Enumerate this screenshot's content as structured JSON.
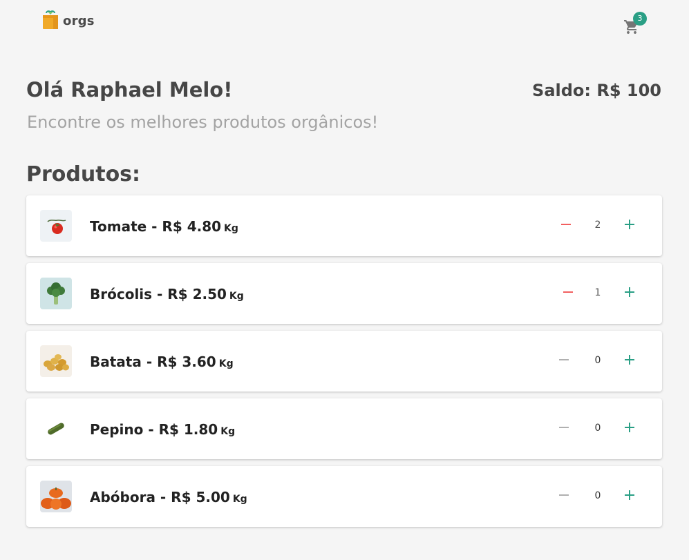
{
  "header": {
    "logo_text": "orgs",
    "cart_count": "3"
  },
  "greeting": {
    "title": "Olá Raphael Melo!",
    "subtitle": "Encontre os melhores produtos orgânicos!",
    "balance": "Saldo: R$ 100"
  },
  "section_title": "Produtos:",
  "products": [
    {
      "name": "Tomate - R$ 4.80",
      "unit": "Kg",
      "quantity": "2",
      "image": "tomato-image"
    },
    {
      "name": "Brócolis - R$ 2.50",
      "unit": "Kg",
      "quantity": "1",
      "image": "broccoli-image"
    },
    {
      "name": "Batata - R$ 3.60",
      "unit": "Kg",
      "quantity": "0",
      "image": "potato-image"
    },
    {
      "name": "Pepino - R$ 1.80",
      "unit": "Kg",
      "quantity": "0",
      "image": "cucumber-image"
    },
    {
      "name": "Abóbora - R$ 5.00",
      "unit": "Kg",
      "quantity": "0",
      "image": "pumpkin-image"
    }
  ],
  "colors": {
    "background": "#f5f5f5",
    "accent": "#2a9f85",
    "minus_active": "#f26060",
    "minus_disabled": "#b0b0b0",
    "text_dark": "#464646",
    "text_muted": "#a3a3a3"
  }
}
